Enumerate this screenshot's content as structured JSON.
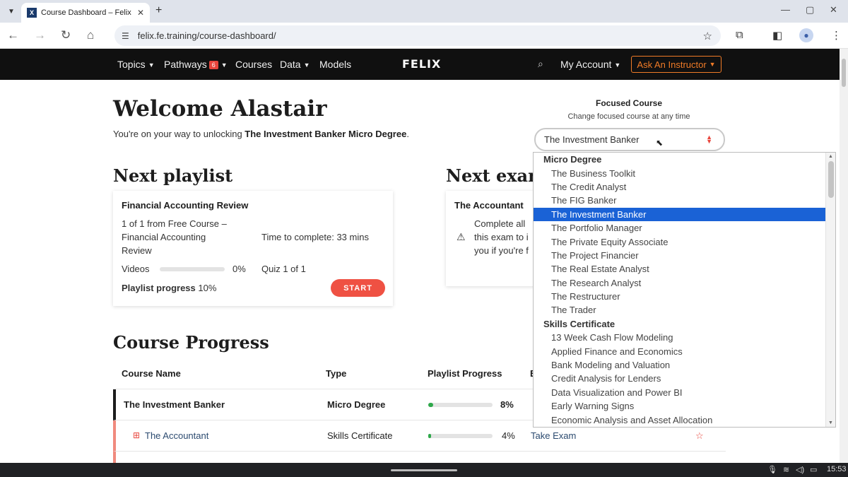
{
  "browser": {
    "tab_title": "Course Dashboard – Felix",
    "favicon_letter": "X",
    "url": "felix.fe.training/course-dashboard/"
  },
  "nav": {
    "topics": "Topics",
    "pathways": "Pathways",
    "pathways_badge": "6",
    "courses": "Courses",
    "data": "Data",
    "models": "Models",
    "logo": "FELIX",
    "my_account": "My Account",
    "ask": "Ask An Instructor"
  },
  "welcome": {
    "title": "Welcome Alastair",
    "sub_prefix": "You're on your way to unlocking ",
    "sub_course": "The Investment Banker Micro Degree",
    "sub_suffix": "."
  },
  "focused": {
    "title": "Focused Course",
    "subtitle": "Change focused course at any time",
    "selected": "The Investment Banker"
  },
  "next_playlist": {
    "heading": "Next playlist",
    "card_title": "Financial Accounting Review",
    "line1": "1 of 1 from Free Course –",
    "line2": "Financial Accounting",
    "line3": "Review",
    "time": "Time to complete: 33 mins",
    "videos_label": "Videos",
    "videos_pct": "0%",
    "videos_value": 0,
    "quiz": "Quiz 1 of 1",
    "progress_label": "Playlist progress",
    "progress_value": "10%",
    "start": "START"
  },
  "next_exam": {
    "heading": "Next exam",
    "card_title": "The Accountant",
    "line1": "Complete all",
    "line2": "this exam to i",
    "line3": "you if you're f"
  },
  "course_progress": {
    "heading": "Course Progress",
    "headers": [
      "Course Name",
      "Type",
      "Playlist Progress",
      "E"
    ],
    "rows": [
      {
        "name": "The Investment Banker",
        "type": "Micro Degree",
        "progress": 8,
        "progress_label": "8%",
        "exam": ""
      },
      {
        "name": "The Accountant",
        "type": "Skills Certificate",
        "progress": 4,
        "progress_label": "4%",
        "exam": "Take Exam"
      }
    ]
  },
  "dropdown": {
    "groups": [
      {
        "label": "Micro Degree",
        "options": [
          "The Business Toolkit",
          "The Credit Analyst",
          "The FIG Banker",
          "The Investment Banker",
          "The Portfolio Manager",
          "The Private Equity Associate",
          "The Project Financier",
          "The Real Estate Analyst",
          "The Research Analyst",
          "The Restructurer",
          "The Trader"
        ]
      },
      {
        "label": "Skills Certificate",
        "options": [
          "13 Week Cash Flow Modeling",
          "Applied Finance and Economics",
          "Bank Modeling and Valuation",
          "Credit Analysis for Lenders",
          "Data Visualization and Power BI",
          "Early Warning Signs",
          "Economic Analysis and Asset Allocation"
        ]
      }
    ],
    "selected": "The Investment Banker"
  },
  "taskbar": {
    "time": "15:53"
  },
  "colors": {
    "accent_red": "#ef5143",
    "orange": "#f07b27",
    "selection_blue": "#1a62d6",
    "progress_green": "#2ea84a",
    "nav_bg": "#101010"
  }
}
